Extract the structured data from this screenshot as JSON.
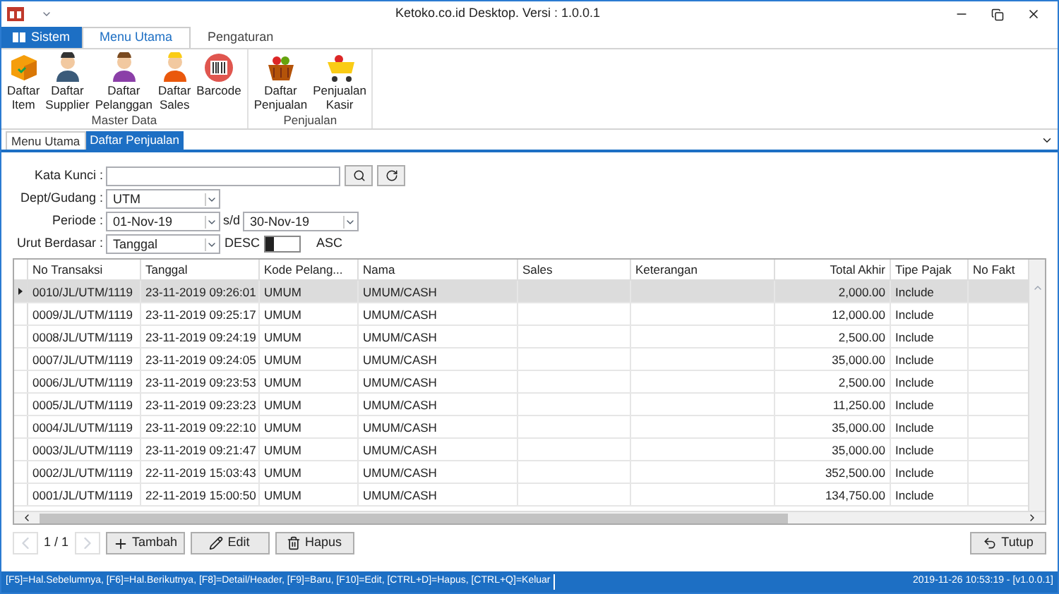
{
  "window": {
    "title": "Ketoko.co.id Desktop. Versi : 1.0.0.1"
  },
  "ribbon_tabs": [
    {
      "label": "Sistem",
      "kind": "app",
      "selected": false
    },
    {
      "label": "Menu Utama",
      "kind": "tab",
      "selected": true
    },
    {
      "label": "Pengaturan",
      "kind": "tab",
      "selected": false
    }
  ],
  "ribbon_groups": [
    {
      "label": "Master Data",
      "buttons": [
        {
          "label": "Daftar Item",
          "kind": "box"
        },
        {
          "label": "Daftar Supplier",
          "kind": "supplier"
        },
        {
          "label": "Daftar Pelanggan",
          "kind": "customer"
        },
        {
          "label": "Daftar Sales",
          "kind": "sales"
        },
        {
          "label": "Barcode",
          "kind": "barcode"
        }
      ]
    },
    {
      "label": "Penjualan",
      "buttons": [
        {
          "label": "Daftar Penjualan",
          "kind": "basket"
        },
        {
          "label": "Penjualan Kasir",
          "kind": "cart"
        }
      ]
    }
  ],
  "doc_tabs": [
    {
      "label": "Menu Utama",
      "selected": false
    },
    {
      "label": "Daftar Penjualan",
      "selected": true
    }
  ],
  "form": {
    "keyword_label": "Kata Kunci :",
    "dept_label": "Dept/Gudang :",
    "dept_value": "UTM",
    "period_label": "Periode :",
    "period_from": "01-Nov-19",
    "period_sep": "s/d",
    "period_to": "30-Nov-19",
    "sort_label": "Urut Berdasar :",
    "sort_value": "Tanggal",
    "desc_label": "DESC",
    "asc_label": "ASC",
    "sort_desc": true
  },
  "table": {
    "columns": [
      "No Transaksi",
      "Tanggal",
      "Kode Pelang...",
      "Nama",
      "Sales",
      "Keterangan",
      "Total Akhir",
      "Tipe Pajak",
      "No Fakt"
    ],
    "rows": [
      {
        "cells": [
          "0010/JL/UTM/1119",
          "23-11-2019 09:26:01",
          "UMUM",
          "UMUM/CASH",
          "",
          "",
          "2,000.00",
          "Include",
          ""
        ],
        "selected": true
      },
      {
        "cells": [
          "0009/JL/UTM/1119",
          "23-11-2019 09:25:17",
          "UMUM",
          "UMUM/CASH",
          "",
          "",
          "12,000.00",
          "Include",
          ""
        ],
        "selected": false
      },
      {
        "cells": [
          "0008/JL/UTM/1119",
          "23-11-2019 09:24:19",
          "UMUM",
          "UMUM/CASH",
          "",
          "",
          "2,500.00",
          "Include",
          ""
        ],
        "selected": false
      },
      {
        "cells": [
          "0007/JL/UTM/1119",
          "23-11-2019 09:24:05",
          "UMUM",
          "UMUM/CASH",
          "",
          "",
          "35,000.00",
          "Include",
          ""
        ],
        "selected": false
      },
      {
        "cells": [
          "0006/JL/UTM/1119",
          "23-11-2019 09:23:53",
          "UMUM",
          "UMUM/CASH",
          "",
          "",
          "2,500.00",
          "Include",
          ""
        ],
        "selected": false
      },
      {
        "cells": [
          "0005/JL/UTM/1119",
          "23-11-2019 09:23:23",
          "UMUM",
          "UMUM/CASH",
          "",
          "",
          "11,250.00",
          "Include",
          ""
        ],
        "selected": false
      },
      {
        "cells": [
          "0004/JL/UTM/1119",
          "23-11-2019 09:22:10",
          "UMUM",
          "UMUM/CASH",
          "",
          "",
          "35,000.00",
          "Include",
          ""
        ],
        "selected": false
      },
      {
        "cells": [
          "0003/JL/UTM/1119",
          "23-11-2019 09:21:47",
          "UMUM",
          "UMUM/CASH",
          "",
          "",
          "35,000.00",
          "Include",
          ""
        ],
        "selected": false
      },
      {
        "cells": [
          "0002/JL/UTM/1119",
          "22-11-2019 15:03:43",
          "UMUM",
          "UMUM/CASH",
          "",
          "",
          "352,500.00",
          "Include",
          ""
        ],
        "selected": false
      },
      {
        "cells": [
          "0001/JL/UTM/1119",
          "22-11-2019 15:00:50",
          "UMUM",
          "UMUM/CASH",
          "",
          "",
          "134,750.00",
          "Include",
          ""
        ],
        "selected": false
      }
    ]
  },
  "pager": "1 / 1",
  "buttons": [
    {
      "label": "Tambah",
      "kind": "add"
    },
    {
      "label": "Edit",
      "kind": "edit"
    },
    {
      "label": "Hapus",
      "kind": "delete"
    }
  ],
  "close_button": "Tutup",
  "status_bar": {
    "shortcuts": "[F5]=Hal.Sebelumnya, [F6]=Hal.Berikutnya, [F8]=Detail/Header, [F9]=Baru, [F10]=Edit, [CTRL+D]=Hapus, [CTRL+Q]=Keluar",
    "info": "2019-11-26 10:53:19 - [v1.0.0.1]"
  }
}
